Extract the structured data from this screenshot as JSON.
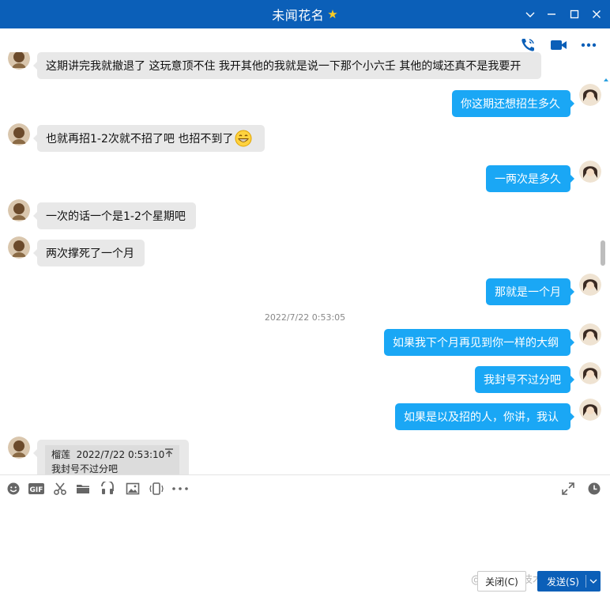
{
  "window": {
    "title": "未闻花名",
    "title_icon": "star-icon"
  },
  "header_actions": [
    "voice-call-icon",
    "video-call-icon",
    "more-icon"
  ],
  "messages": [
    {
      "side": "in",
      "text": "这期讲完我就撤退了 这玩意顶不住 我开其他的我就是说一下那个小六壬 其他的域还真不是我要开"
    },
    {
      "side": "out",
      "text": "你这期还想招生多久"
    },
    {
      "side": "in",
      "text": "也就再招1-2次就不招了吧 也招不到了",
      "emoji": "grin-emoji"
    },
    {
      "side": "out",
      "text": "一两次是多久"
    },
    {
      "side": "in",
      "text": "一次的话一个是1-2个星期吧"
    },
    {
      "side": "in",
      "text": "两次撑死了一个月"
    },
    {
      "side": "out",
      "text": "那就是一个月"
    },
    {
      "side": "out",
      "text": "如果我下个月再见到你一样的大纲"
    },
    {
      "side": "out",
      "text": "我封号不过分吧"
    },
    {
      "side": "out",
      "text": "如果是以及招的人，你讲，我认"
    }
  ],
  "timestamp": "2022/7/22 0:53:05",
  "quote": {
    "sender": "榴莲",
    "time": "2022/7/22 0:53:10",
    "text": "我封号不过分吧"
  },
  "toolbar": [
    "emoji-icon",
    "gif-icon",
    "scissors-icon",
    "folder-icon",
    "music-icon",
    "image-icon",
    "shake-icon",
    "more-tools-icon"
  ],
  "toolbar_right": [
    "expand-icon",
    "history-clock-icon"
  ],
  "buttons": {
    "close_label": "关闭(C)",
    "send_label": "发送(S)"
  },
  "watermark": "@稀土掘金技术社区",
  "colors": {
    "titlebar": "#0b5fb8",
    "outgoing_bubble": "#1aa7f5",
    "incoming_bubble": "#e8e8e8",
    "send_button": "#0b5fb8"
  }
}
